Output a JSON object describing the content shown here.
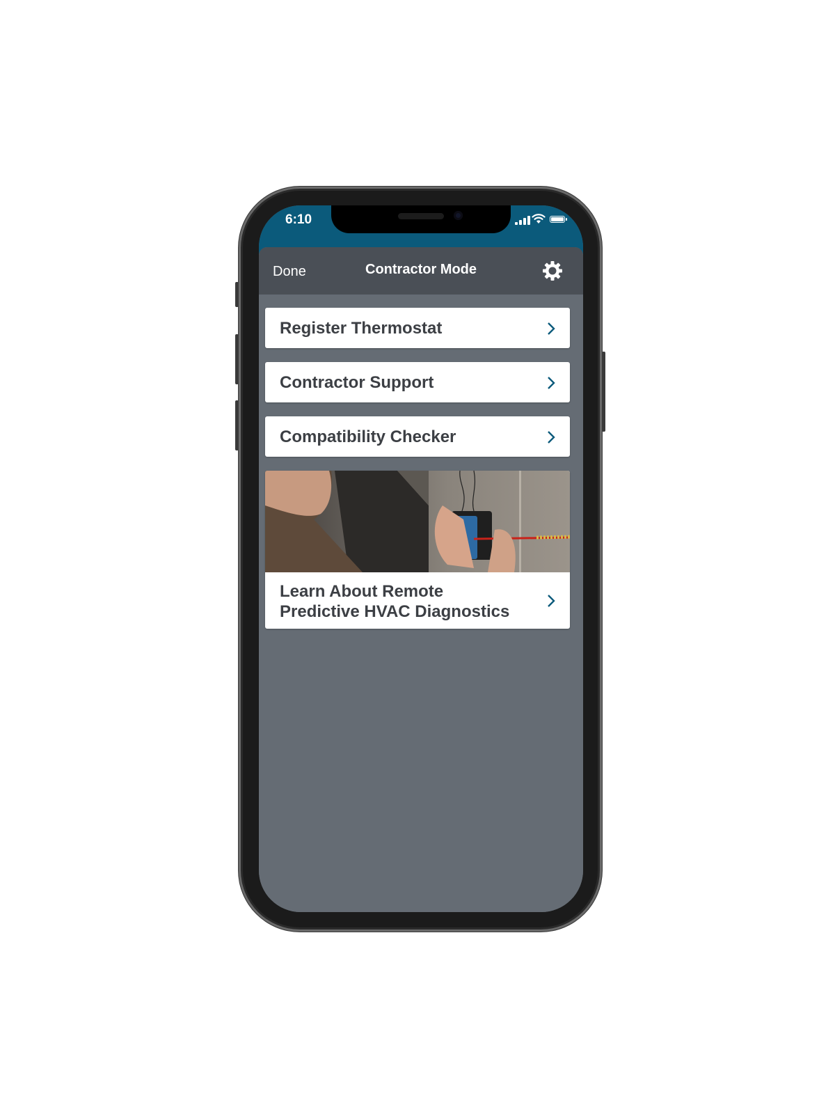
{
  "status_bar": {
    "time": "6:10",
    "icons": [
      "cellular-signal-icon",
      "wifi-icon",
      "battery-icon"
    ]
  },
  "nav": {
    "done_label": "Done",
    "title": "Contractor Mode",
    "settings_icon": "gear-icon"
  },
  "menu": {
    "items": [
      {
        "label": "Register Thermostat",
        "icon": "chevron-right-icon"
      },
      {
        "label": "Contractor Support",
        "icon": "chevron-right-icon"
      },
      {
        "label": "Compatibility Checker",
        "icon": "chevron-right-icon"
      }
    ],
    "promo": {
      "line1": "Learn About Remote",
      "line2": "Predictive HVAC Diagnostics",
      "image": "technician-installing-sensor-photo",
      "icon": "chevron-right-icon"
    }
  },
  "colors": {
    "status_bar": "#0b5a7b",
    "nav_bar": "#4a4f56",
    "background": "#656c74",
    "card": "#ffffff",
    "card_text": "#3c3f44",
    "chevron": "#0b5a7b"
  }
}
